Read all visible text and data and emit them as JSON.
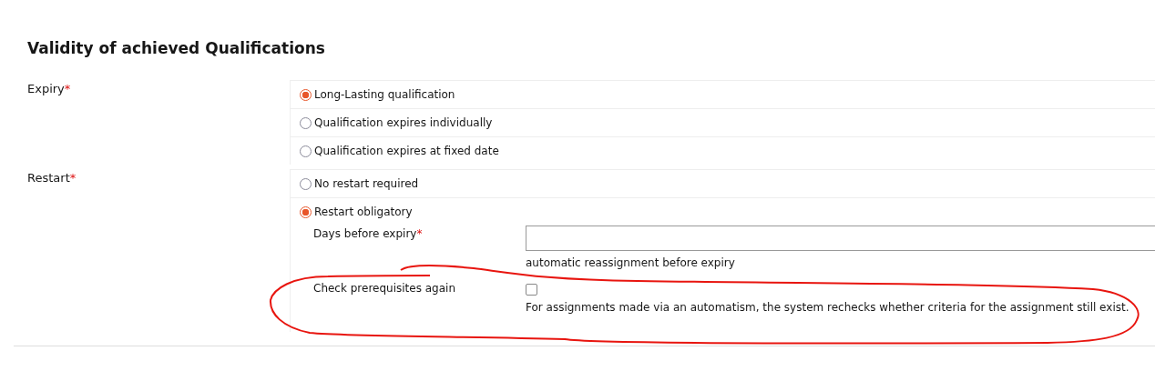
{
  "section": {
    "title": "Validity of achieved Qualifications",
    "fields": [
      {
        "label": "Expiry",
        "required_mark": "*",
        "options": [
          {
            "label": "Long-Lasting qualification",
            "selected": true
          },
          {
            "label": "Qualification expires individually",
            "selected": false
          },
          {
            "label": "Qualification expires at fixed date",
            "selected": false
          }
        ]
      },
      {
        "label": "Restart",
        "required_mark": "*",
        "options": [
          {
            "label": "No restart required",
            "selected": false
          },
          {
            "label": "Restart obligatory",
            "selected": true,
            "subfields": [
              {
                "kind": "number",
                "label": "Days before expiry",
                "required_mark": "*",
                "help": "automatic reassignment before expiry"
              },
              {
                "kind": "checkbox",
                "label": "Check prerequisites again",
                "checked": false,
                "help": "For assignments made via an automatism, the system rechecks whether criteria for the assignment still exist."
              }
            ]
          }
        ]
      }
    ]
  }
}
